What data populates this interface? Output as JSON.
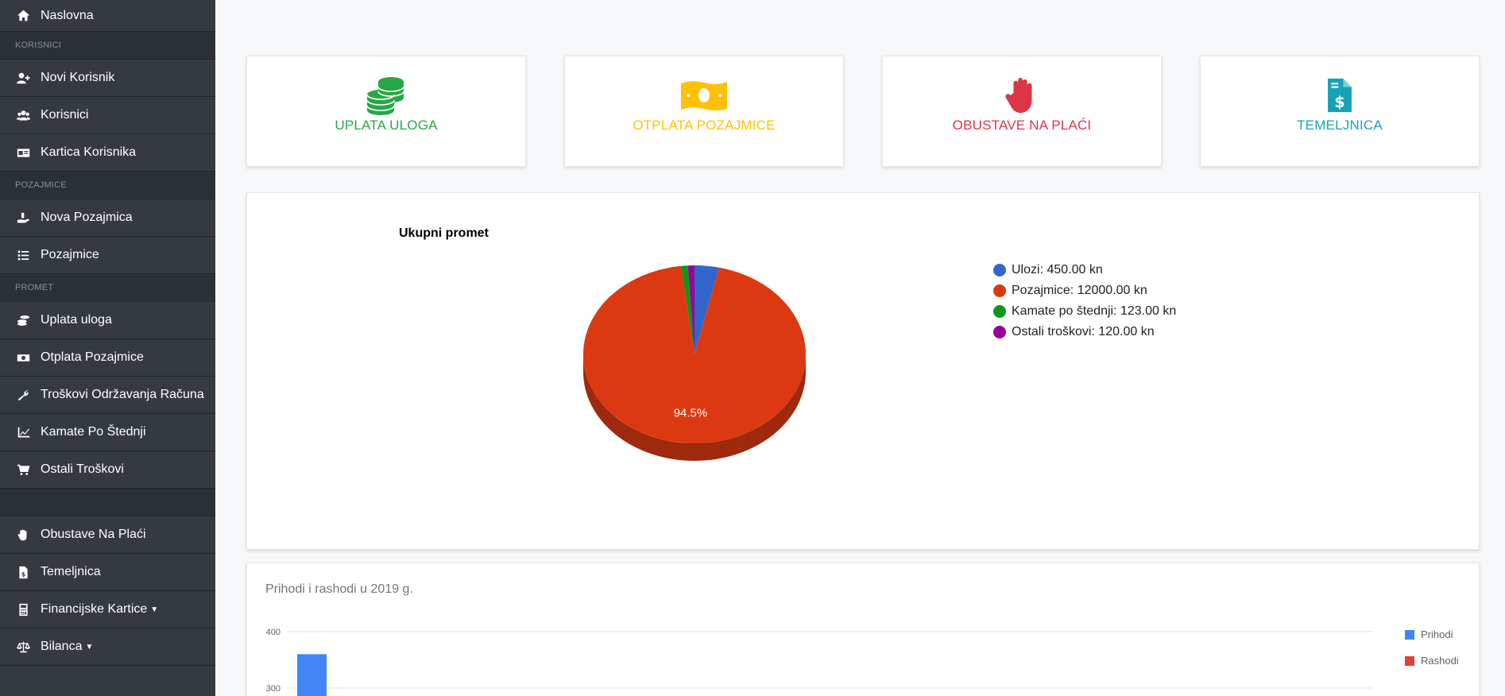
{
  "sidebar": {
    "home": "Naslovna",
    "section_users": "KORISNICI",
    "new_user": "Novi Korisnik",
    "users": "Korisnici",
    "user_card": "Kartica Korisnika",
    "section_loans": "POZAJMICE",
    "new_loan": "Nova Pozajmica",
    "loans": "Pozajmice",
    "section_traffic": "PROMET",
    "deposit": "Uplata uloga",
    "loan_repayment": "Otplata Pozajmice",
    "maintenance_costs": "Troškovi Održavanja Računa",
    "savings_interest": "Kamate Po Štednji",
    "other_costs": "Ostali Troškovi",
    "salary_deductions": "Obustave Na Plaći",
    "journal": "Temeljnica",
    "financial_cards": "Financijske Kartice",
    "balance": "Bilanca"
  },
  "quick_cards": {
    "deposit": "UPLATA ULOGA",
    "repayment": "OTPLATA POZAJMICE",
    "deductions": "OBUSTAVE NA PLAĆI",
    "journal": "TEMELJNICA"
  },
  "colors": {
    "green": "#28a745",
    "yellow": "#ffc107",
    "red": "#dc3545",
    "teal": "#17a2b8"
  },
  "chart_data": [
    {
      "type": "pie",
      "title": "Ukupni promet",
      "slices": [
        {
          "label": "Ulozi: 450.00 kn",
          "value": 450.0,
          "color": "#3366cc"
        },
        {
          "label": "Pozajmice: 12000.00 kn",
          "value": 12000.0,
          "color": "#dc3912"
        },
        {
          "label": "Kamate po štednji: 123.00 kn",
          "value": 123.0,
          "color": "#109618"
        },
        {
          "label": "Ostali troškovi: 120.00 kn",
          "value": 120.0,
          "color": "#990099"
        }
      ],
      "data_label": "94.5%",
      "legend_position": "right"
    },
    {
      "type": "bar",
      "title": "Prihodi i rashodi u 2019 g.",
      "y_ticks": [
        "400",
        "300"
      ],
      "series": [
        {
          "name": "Prihodi",
          "color": "#4285f4",
          "values": [
            360
          ]
        },
        {
          "name": "Rashodi",
          "color": "#db4437",
          "values": []
        }
      ],
      "legend_position": "right"
    }
  ]
}
